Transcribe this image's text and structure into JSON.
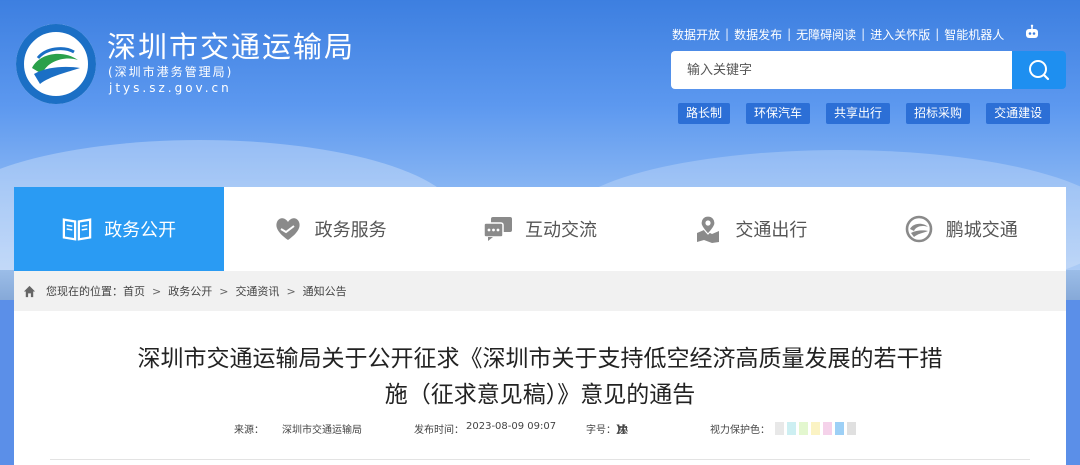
{
  "header": {
    "title": "深圳市交通运输局",
    "subtitle": "(深圳市港务管理局)",
    "url": "jtys.sz.gov.cn",
    "logo_text": "深圳市交通运输局",
    "top_links": [
      "数据开放",
      "数据发布",
      "无障碍阅读",
      "进入关怀版",
      "智能机器人"
    ],
    "search": {
      "placeholder": "输入关键字"
    },
    "quick_tags": [
      "路长制",
      "环保汽车",
      "共享出行",
      "招标采购",
      "交通建设"
    ]
  },
  "nav": {
    "items": [
      {
        "label": "政务公开",
        "icon": "book-icon",
        "active": true
      },
      {
        "label": "政务服务",
        "icon": "heart-hands-icon",
        "active": false
      },
      {
        "label": "互动交流",
        "icon": "chat-icon",
        "active": false
      },
      {
        "label": "交通出行",
        "icon": "map-pin-icon",
        "active": false
      },
      {
        "label": "鹏城交通",
        "icon": "swirl-icon",
        "active": false
      }
    ]
  },
  "breadcrumb": {
    "prefix": "您现在的位置：",
    "items": [
      "首页",
      "政务公开",
      "交通资讯",
      "通知公告"
    ],
    "separator": ">"
  },
  "article": {
    "title_line1": "深圳市交通运输局关于公开征求《深圳市关于支持低空经济高质量发展的若干措",
    "title_line2": "施（征求意见稿）》意见的通告",
    "source_label": "来源：",
    "source_value": "深圳市交通运输局",
    "date_label": "发布时间：",
    "date_value": "2023-08-09 09:07",
    "font_label": "字号：",
    "font_open": "【",
    "font_sizes": [
      "大",
      "中",
      "小"
    ],
    "font_close": "】",
    "eye_label": "视力保护色：",
    "eye_colors": [
      "#e8e8e8",
      "#cdeff2",
      "#e3f7cf",
      "#fbf3c4",
      "#f5d2ea",
      "#9dd0f6",
      "#e0e0e0"
    ]
  }
}
